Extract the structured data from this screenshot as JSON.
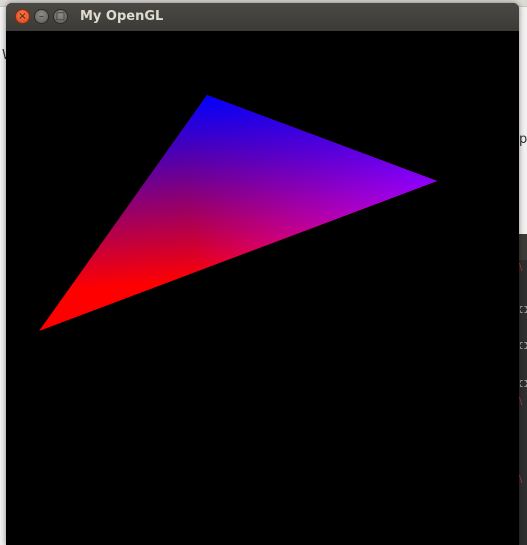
{
  "window": {
    "title": "My OpenGL",
    "close_icon": "close-icon",
    "minimize_icon": "minimize-icon",
    "maximize_icon": "maximize-icon"
  },
  "scene": {
    "background": "#000000",
    "triangle": {
      "vertex_colors": [
        "#0000ff",
        "#ff00ff",
        "#ff0000"
      ]
    }
  },
  "background_fragments": {
    "left_letter": "W",
    "right_letter": "p"
  }
}
